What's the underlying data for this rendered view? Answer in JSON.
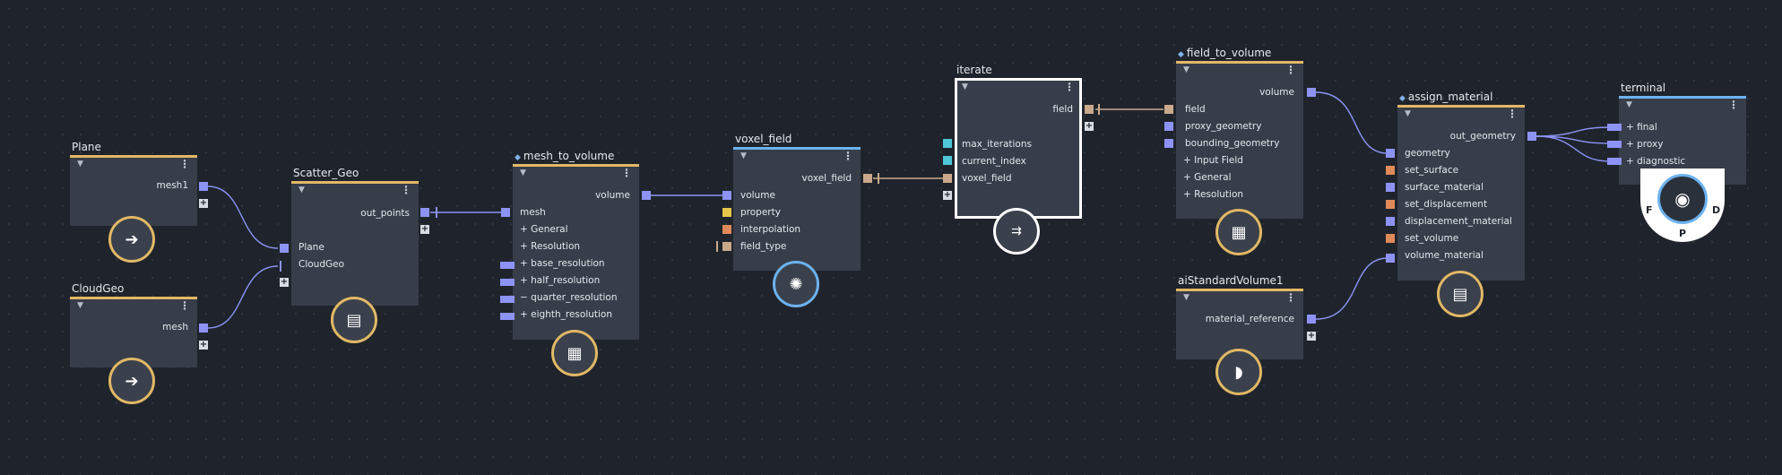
{
  "colors": {
    "background": "#1f242c",
    "node_body": "#373e4a",
    "accent_gold": "#e2b865",
    "accent_blue": "#6db2ef",
    "port_blue": "#8d93f5",
    "port_tan": "#c9a98a",
    "port_orange": "#e08a5a",
    "port_yellow": "#e6c54a",
    "selected_border": "#ffffff"
  },
  "nodes": {
    "plane": {
      "title": "Plane",
      "outputs": [
        "mesh1"
      ],
      "icon": "arrow-right-icon"
    },
    "cloudgeo": {
      "title": "CloudGeo",
      "outputs": [
        "mesh"
      ],
      "icon": "arrow-right-icon"
    },
    "scatter_geo": {
      "title": "Scatter_Geo",
      "outputs": [
        "out_points"
      ],
      "inputs": [
        "Plane",
        "CloudGeo"
      ],
      "icon": "merge-icon"
    },
    "mesh_to_volume": {
      "title": "mesh_to_volume",
      "outputs": [
        "volume"
      ],
      "inputs": [
        "mesh",
        "General",
        "Resolution",
        "base_resolution",
        "half_resolution",
        "quarter_resolution",
        "eighth_resolution"
      ],
      "input_prefixes": [
        "",
        "+",
        "+",
        "+",
        "+",
        "−",
        "+"
      ],
      "icon": "cube-icon"
    },
    "voxel_field": {
      "title": "voxel_field",
      "outputs": [
        "voxel_field"
      ],
      "inputs": [
        "volume",
        "property",
        "interpolation",
        "field_type"
      ],
      "icon": "swirl-icon"
    },
    "iterate": {
      "title": "iterate",
      "outputs": [
        "field"
      ],
      "inputs": [
        "max_iterations",
        "current_index",
        "voxel_field"
      ],
      "icon": "iterate-icon"
    },
    "field_to_volume": {
      "title": "field_to_volume",
      "outputs": [
        "volume"
      ],
      "inputs": [
        "field",
        "proxy_geometry",
        "bounding_geometry",
        "Input Field",
        "General",
        "Resolution"
      ],
      "input_prefixes": [
        "",
        "",
        "",
        "+",
        "+",
        "+"
      ],
      "icon": "cube-icon"
    },
    "assign_material": {
      "title": "assign_material",
      "outputs": [
        "out_geometry"
      ],
      "inputs": [
        "geometry",
        "set_surface",
        "surface_material",
        "set_displacement",
        "displacement_material",
        "set_volume",
        "volume_material"
      ],
      "icon": "merge-icon"
    },
    "aistandardvolume1": {
      "title": "aiStandardVolume1",
      "outputs": [
        "material_reference"
      ],
      "icon": "half-circle-icon"
    },
    "terminal": {
      "title": "terminal",
      "inputs": [
        "final",
        "proxy",
        "diagnostic"
      ],
      "icon": "eye-icon",
      "dial_labels": [
        "F",
        "P",
        "D"
      ]
    }
  }
}
